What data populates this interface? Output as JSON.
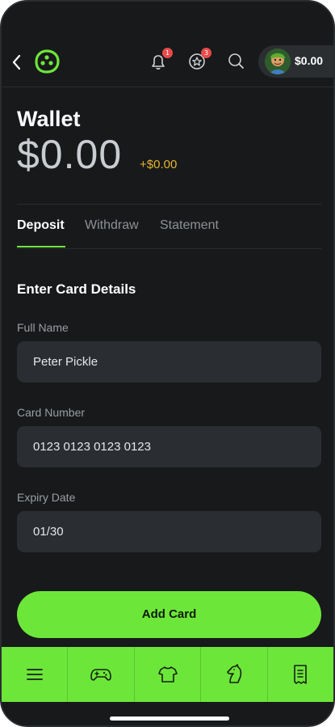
{
  "header": {
    "notifications_badge": "1",
    "rewards_badge": "3",
    "balance": "$0.00"
  },
  "wallet": {
    "title": "Wallet",
    "balance": "$0.00",
    "delta": "+$0.00"
  },
  "tabs": [
    {
      "label": "Deposit",
      "active": true
    },
    {
      "label": "Withdraw",
      "active": false
    },
    {
      "label": "Statement",
      "active": false
    }
  ],
  "form": {
    "title": "Enter Card Details",
    "full_name_label": "Full Name",
    "full_name_value": "Peter Pickle",
    "card_number_label": "Card Number",
    "card_number_value": "0123 0123 0123 0123",
    "expiry_label": "Expiry Date",
    "expiry_value": "01/30",
    "submit_label": "Add Card"
  },
  "bottom_nav": [
    {
      "icon": "menu-icon"
    },
    {
      "icon": "gamepad-icon"
    },
    {
      "icon": "jersey-icon"
    },
    {
      "icon": "horse-icon"
    },
    {
      "icon": "receipt-icon"
    }
  ],
  "colors": {
    "accent": "#6de63a",
    "background": "#17191b",
    "field_bg": "#2a2d31",
    "delta": "#e6b52f",
    "badge": "#e84a4a"
  }
}
